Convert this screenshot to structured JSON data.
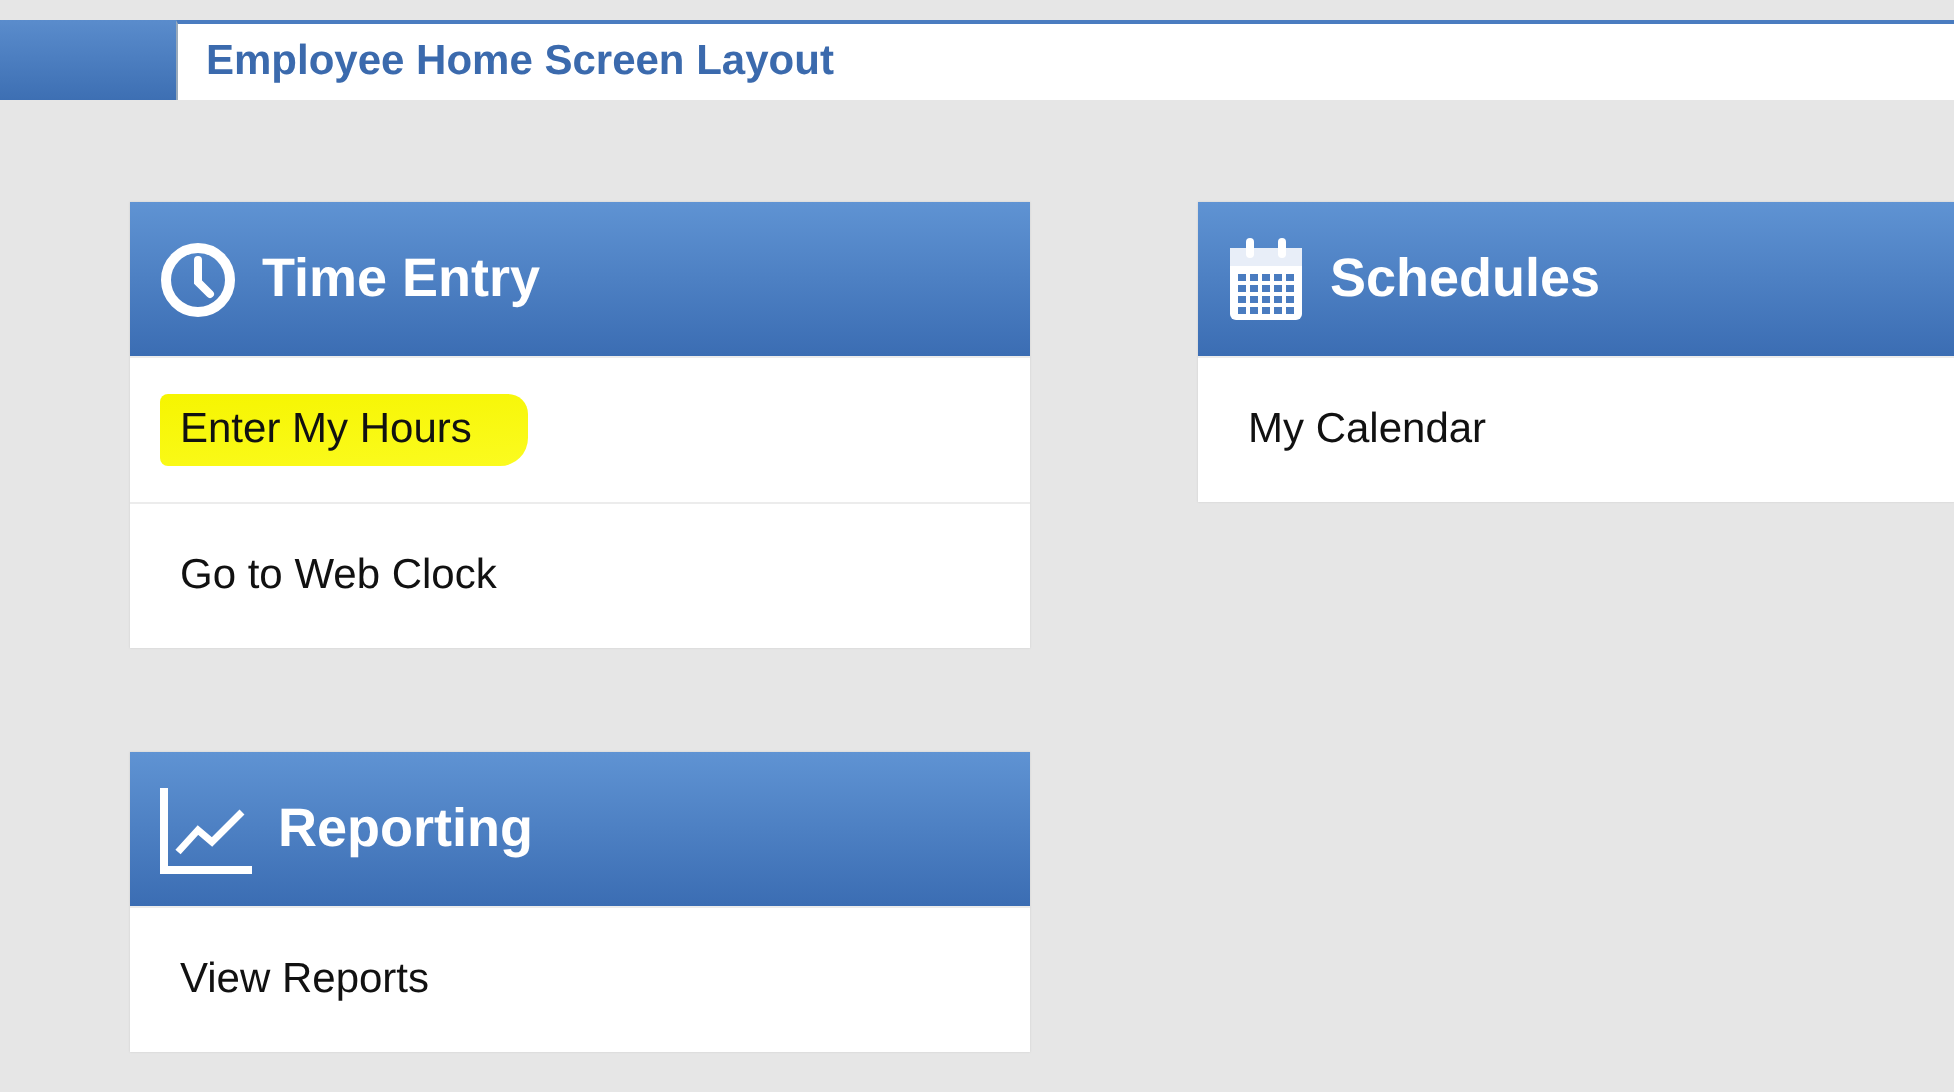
{
  "window": {
    "title": "Employee Home Screen Layout"
  },
  "columns": [
    {
      "cards": [
        {
          "kind": "clock",
          "title": "Time Entry",
          "items": [
            {
              "label": "Enter My Hours",
              "highlighted": true
            },
            {
              "label": "Go to Web Clock",
              "highlighted": false
            }
          ]
        },
        {
          "kind": "chart",
          "title": "Reporting",
          "items": [
            {
              "label": "View Reports",
              "highlighted": false
            }
          ]
        }
      ]
    },
    {
      "cards": [
        {
          "kind": "calendar",
          "title": "Schedules",
          "items": [
            {
              "label": "My Calendar",
              "highlighted": false
            }
          ]
        }
      ]
    }
  ]
}
